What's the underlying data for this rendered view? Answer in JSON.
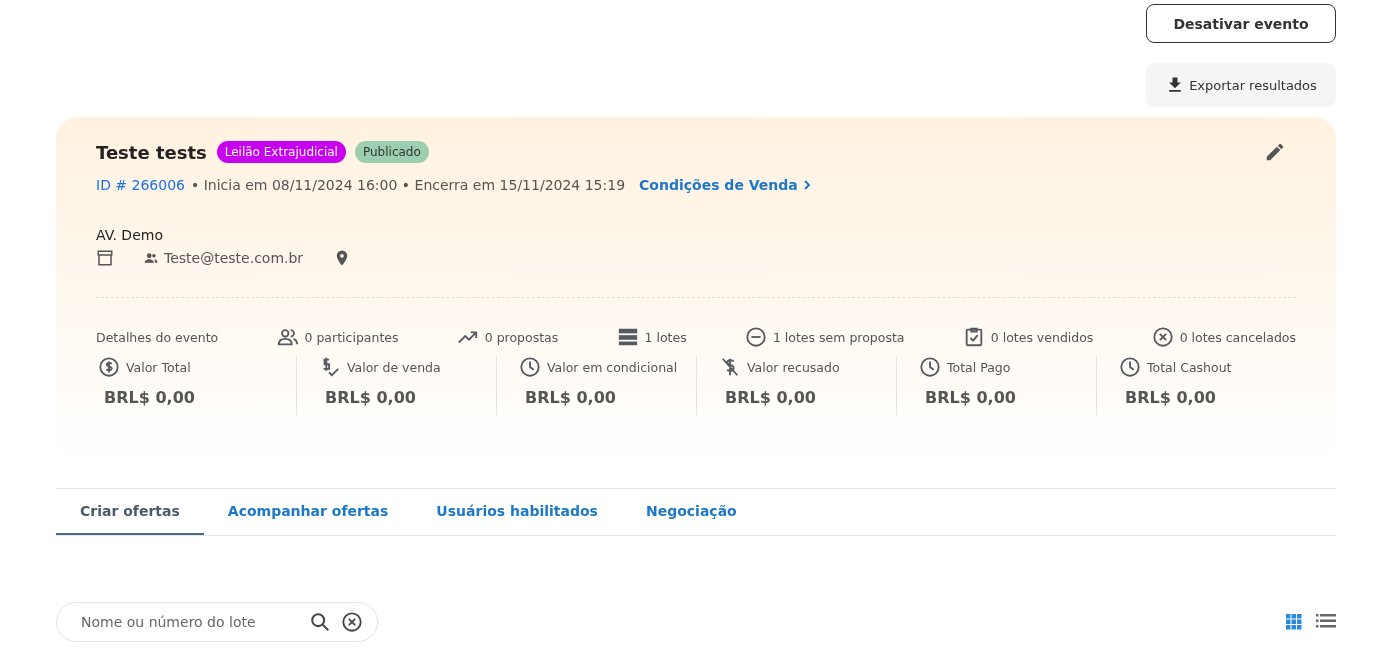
{
  "actions": {
    "deactivate": "Desativar evento",
    "export": "Exportar resultados"
  },
  "event": {
    "title": "Teste tests",
    "tags": [
      {
        "label": "Leilão Extrajudicial",
        "color": "#c800f0"
      },
      {
        "label": "Publicado",
        "color": "#9ccfb0"
      }
    ],
    "id": "ID # 266006",
    "schedule": "• Inicia em 08/11/2024 16:00 • Encerra em 15/11/2024 15:19",
    "conditions_link": "Condições de Venda",
    "organizer": "AV. Demo",
    "email": "Teste@teste.com.br"
  },
  "details_label": "Detalhes do evento",
  "stats": [
    {
      "kind": "people",
      "label": "0 participantes"
    },
    {
      "kind": "trend",
      "label": "0 propostas"
    },
    {
      "kind": "stack",
      "label": "1 lotes"
    },
    {
      "kind": "minus",
      "label": "1 lotes sem proposta"
    },
    {
      "kind": "clipboard",
      "label": "0 lotes vendidos"
    },
    {
      "kind": "cancel",
      "label": "0 lotes cancelados"
    }
  ],
  "metrics": [
    {
      "kind": "dollar",
      "label": "Valor Total",
      "value": "BRL$ 0,00"
    },
    {
      "kind": "sale",
      "label": "Valor de venda",
      "value": "BRL$ 0,00"
    },
    {
      "kind": "clock",
      "label": "Valor em condicional",
      "value": "BRL$ 0,00"
    },
    {
      "kind": "nodollar",
      "label": "Valor recusado",
      "value": "BRL$ 0,00"
    },
    {
      "kind": "clock",
      "label": "Total Pago",
      "value": "BRL$ 0,00"
    },
    {
      "kind": "clock",
      "label": "Total Cashout",
      "value": "BRL$ 0,00"
    }
  ],
  "tabs": [
    {
      "label": "Criar ofertas",
      "selected": true
    },
    {
      "label": "Acompanhar ofertas",
      "selected": false
    },
    {
      "label": "Usuários habilitados",
      "selected": false
    },
    {
      "label": "Negociação",
      "selected": false
    }
  ],
  "search": {
    "placeholder": "Nome ou número do lote"
  },
  "view_modes": [
    {
      "kind": "grid",
      "selected": true
    },
    {
      "kind": "list",
      "selected": false
    }
  ]
}
